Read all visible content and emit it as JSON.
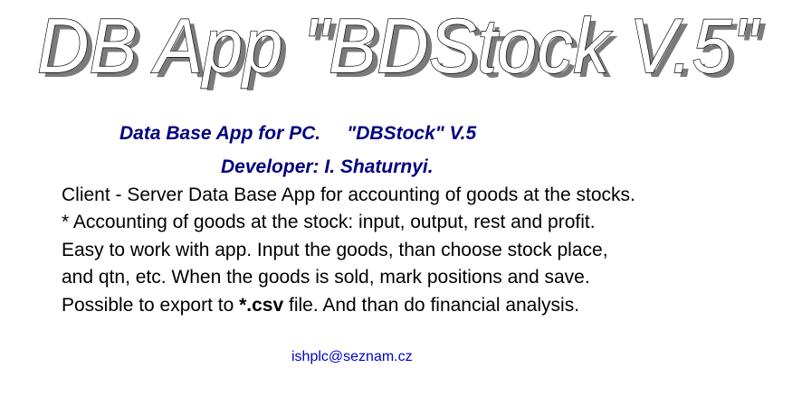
{
  "banner": {
    "title": "DB App \"BDStock V.5\""
  },
  "heading": {
    "line1_part1": "Data Base App for PC.",
    "line1_part2": "\"DBStock\" V.5",
    "line2": "Developer: I. Shaturnyi."
  },
  "description": {
    "line1": "Client - Server Data Base App for accounting of goods at the stocks.",
    "line2": "* Accounting of goods at the stock: input, output, rest and profit.",
    "line3": "Easy to work with app. Input the goods, than choose stock place,",
    "line4": "and qtn, etc. When the goods is sold, mark positions and save.",
    "line5_before": "Possible to export to ",
    "line5_bold": "*.csv",
    "line5_after": " file. And than do financial analysis."
  },
  "contact": {
    "email": "ishplc@seznam.cz"
  }
}
